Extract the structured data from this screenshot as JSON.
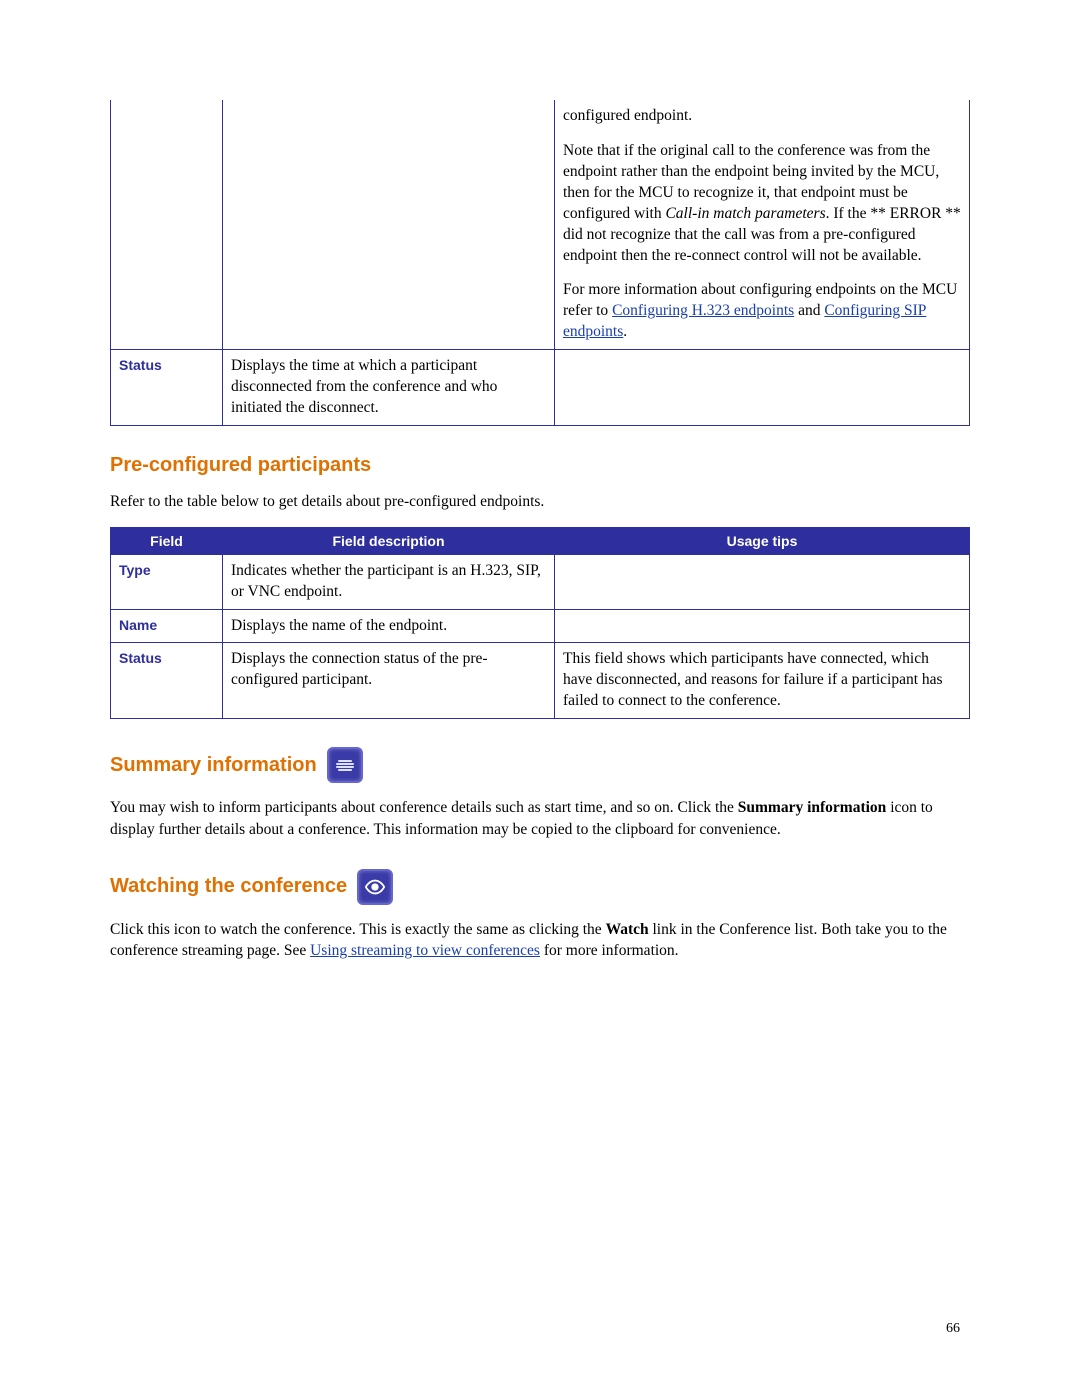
{
  "table1": {
    "row_cont": {
      "tips_p1_prefix": "configured endpoint.",
      "tips_p2_a": "Note that if the original call to the conference was from the endpoint rather than the endpoint being invited by the MCU, then for the MCU to recognize it, that endpoint must be configured with ",
      "tips_p2_em": "Call-in match parameters",
      "tips_p2_b": ". If the ** ERROR ** did not recognize that the call was from a pre-configured endpoint then the re-connect control will not be available.",
      "tips_p3_a": "For more information about configuring endpoints on the MCU refer to ",
      "tips_p3_link1": "Configuring H.323 endpoints",
      "tips_p3_b": " and ",
      "tips_p3_link2": "Configuring SIP endpoints",
      "tips_p3_c": "."
    },
    "row_status": {
      "field": "Status",
      "desc": "Displays the time at which a participant disconnected from the conference and who initiated the disconnect."
    }
  },
  "section_pre": {
    "heading": "Pre-configured participants",
    "intro": "Refer to the table below to get details about pre-configured endpoints."
  },
  "table2": {
    "headers": {
      "field": "Field",
      "desc": "Field description",
      "tips": "Usage tips"
    },
    "rows": {
      "type": {
        "field": "Type",
        "desc": "Indicates whether the participant is an H.323, SIP, or VNC endpoint.",
        "tips": ""
      },
      "name": {
        "field": "Name",
        "desc": "Displays the name of the endpoint.",
        "tips": ""
      },
      "status": {
        "field": "Status",
        "desc": "Displays the connection status of the pre-configured participant.",
        "tips": "This field shows which participants have connected, which have disconnected, and reasons for failure if a participant has failed to connect to the conference."
      }
    }
  },
  "section_summary": {
    "heading": "Summary information",
    "body_a": "You may wish to inform participants about conference details such as start time, and so on. Click the ",
    "body_strong": "Summary information",
    "body_b": " icon to display further details about a conference. This information may be copied to the clipboard for convenience."
  },
  "section_watch": {
    "heading": "Watching the conference",
    "body_a": "Click this icon to watch the conference. This is exactly the same as clicking the ",
    "body_strong": "Watch",
    "body_b": " link in the Conference list. Both take you to the conference streaming page. See ",
    "body_link": "Using streaming to view conferences",
    "body_c": " for more information."
  },
  "page_number": "66"
}
